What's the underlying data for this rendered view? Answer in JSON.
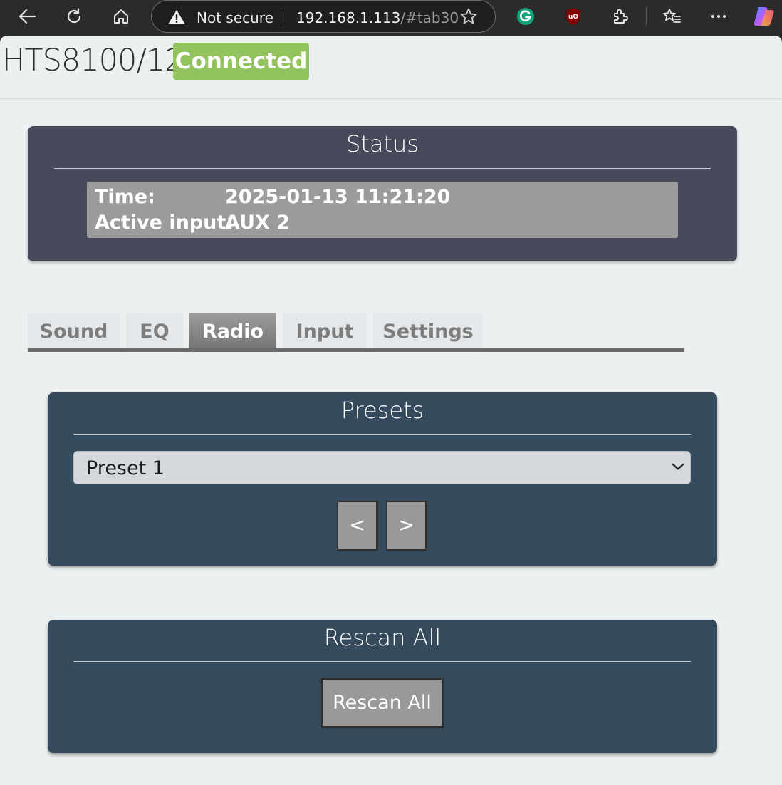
{
  "browser": {
    "security_label": "Not secure",
    "url_host": "192.168.1.113",
    "url_fragment": "/#tab30"
  },
  "header": {
    "model": "HTS8100/12",
    "connection_status": "Connected",
    "status_color": "#93c35f"
  },
  "status": {
    "title": "Status",
    "time_label": "Time:",
    "time_value": "2025-01-13 11:21:20",
    "input_label": "Active input:",
    "input_value": "AUX 2"
  },
  "tabs": [
    {
      "label": "Sound",
      "active": false
    },
    {
      "label": "EQ",
      "active": false
    },
    {
      "label": "Radio",
      "active": true
    },
    {
      "label": "Input",
      "active": false
    },
    {
      "label": "Settings",
      "active": false
    }
  ],
  "presets": {
    "title": "Presets",
    "selected": "Preset 1",
    "prev_label": "<",
    "next_label": ">"
  },
  "rescan": {
    "title": "Rescan All",
    "button_label": "Rescan All"
  },
  "colors": {
    "status_panel": "#464a5a",
    "radio_panel": "#364a5e",
    "page_bg": "#edf0f1"
  }
}
